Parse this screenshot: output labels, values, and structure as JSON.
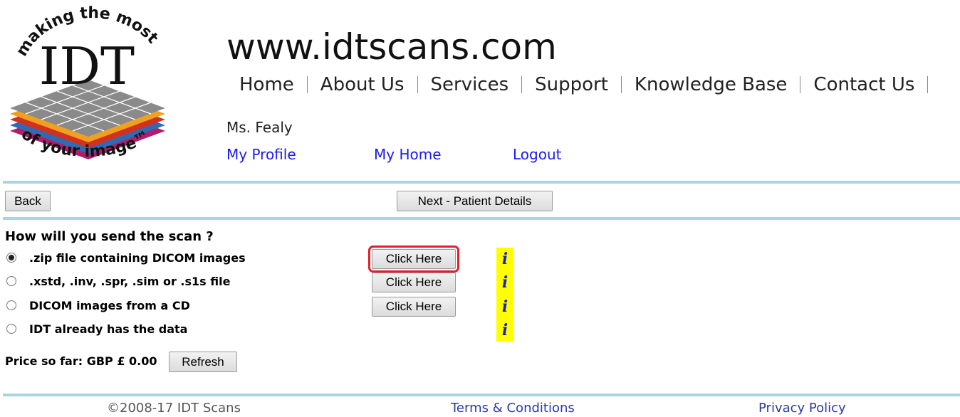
{
  "logo": {
    "arc_top": "making the most",
    "main": "IDT",
    "arc_bottom": "of your image™"
  },
  "header": {
    "site_title": "www.idtscans.com",
    "nav": [
      "Home",
      "About Us",
      "Services",
      "Support",
      "Knowledge Base",
      "Contact Us"
    ]
  },
  "user": {
    "name": "Ms. Fealy",
    "links": {
      "profile": "My Profile",
      "home": "My Home",
      "logout": "Logout"
    }
  },
  "toolbar": {
    "back_label": "Back",
    "next_label": "Next - Patient Details"
  },
  "send_scan": {
    "question": "How will you send the scan ?",
    "options": [
      {
        "label": ".zip file containing DICOM images",
        "selected": true,
        "button": "Click Here"
      },
      {
        "label": ".xstd, .inv, .spr, .sim or .s1s file",
        "selected": false,
        "button": "Click Here"
      },
      {
        "label": "DICOM images from a CD",
        "selected": false,
        "button": "Click Here"
      },
      {
        "label": "IDT already has the data",
        "selected": false
      }
    ],
    "info_glyph": "i"
  },
  "price": {
    "label": "Price so far: GBP £ 0.00",
    "refresh_label": "Refresh"
  },
  "footer": {
    "copyright": "©2008-17 IDT Scans",
    "terms": "Terms & Conditions",
    "privacy": "Privacy Policy"
  },
  "colors": {
    "link": "#1a1af0",
    "rule": "#a9d5e3",
    "highlight": "#e0202a",
    "info_bg": "#ffff00"
  }
}
